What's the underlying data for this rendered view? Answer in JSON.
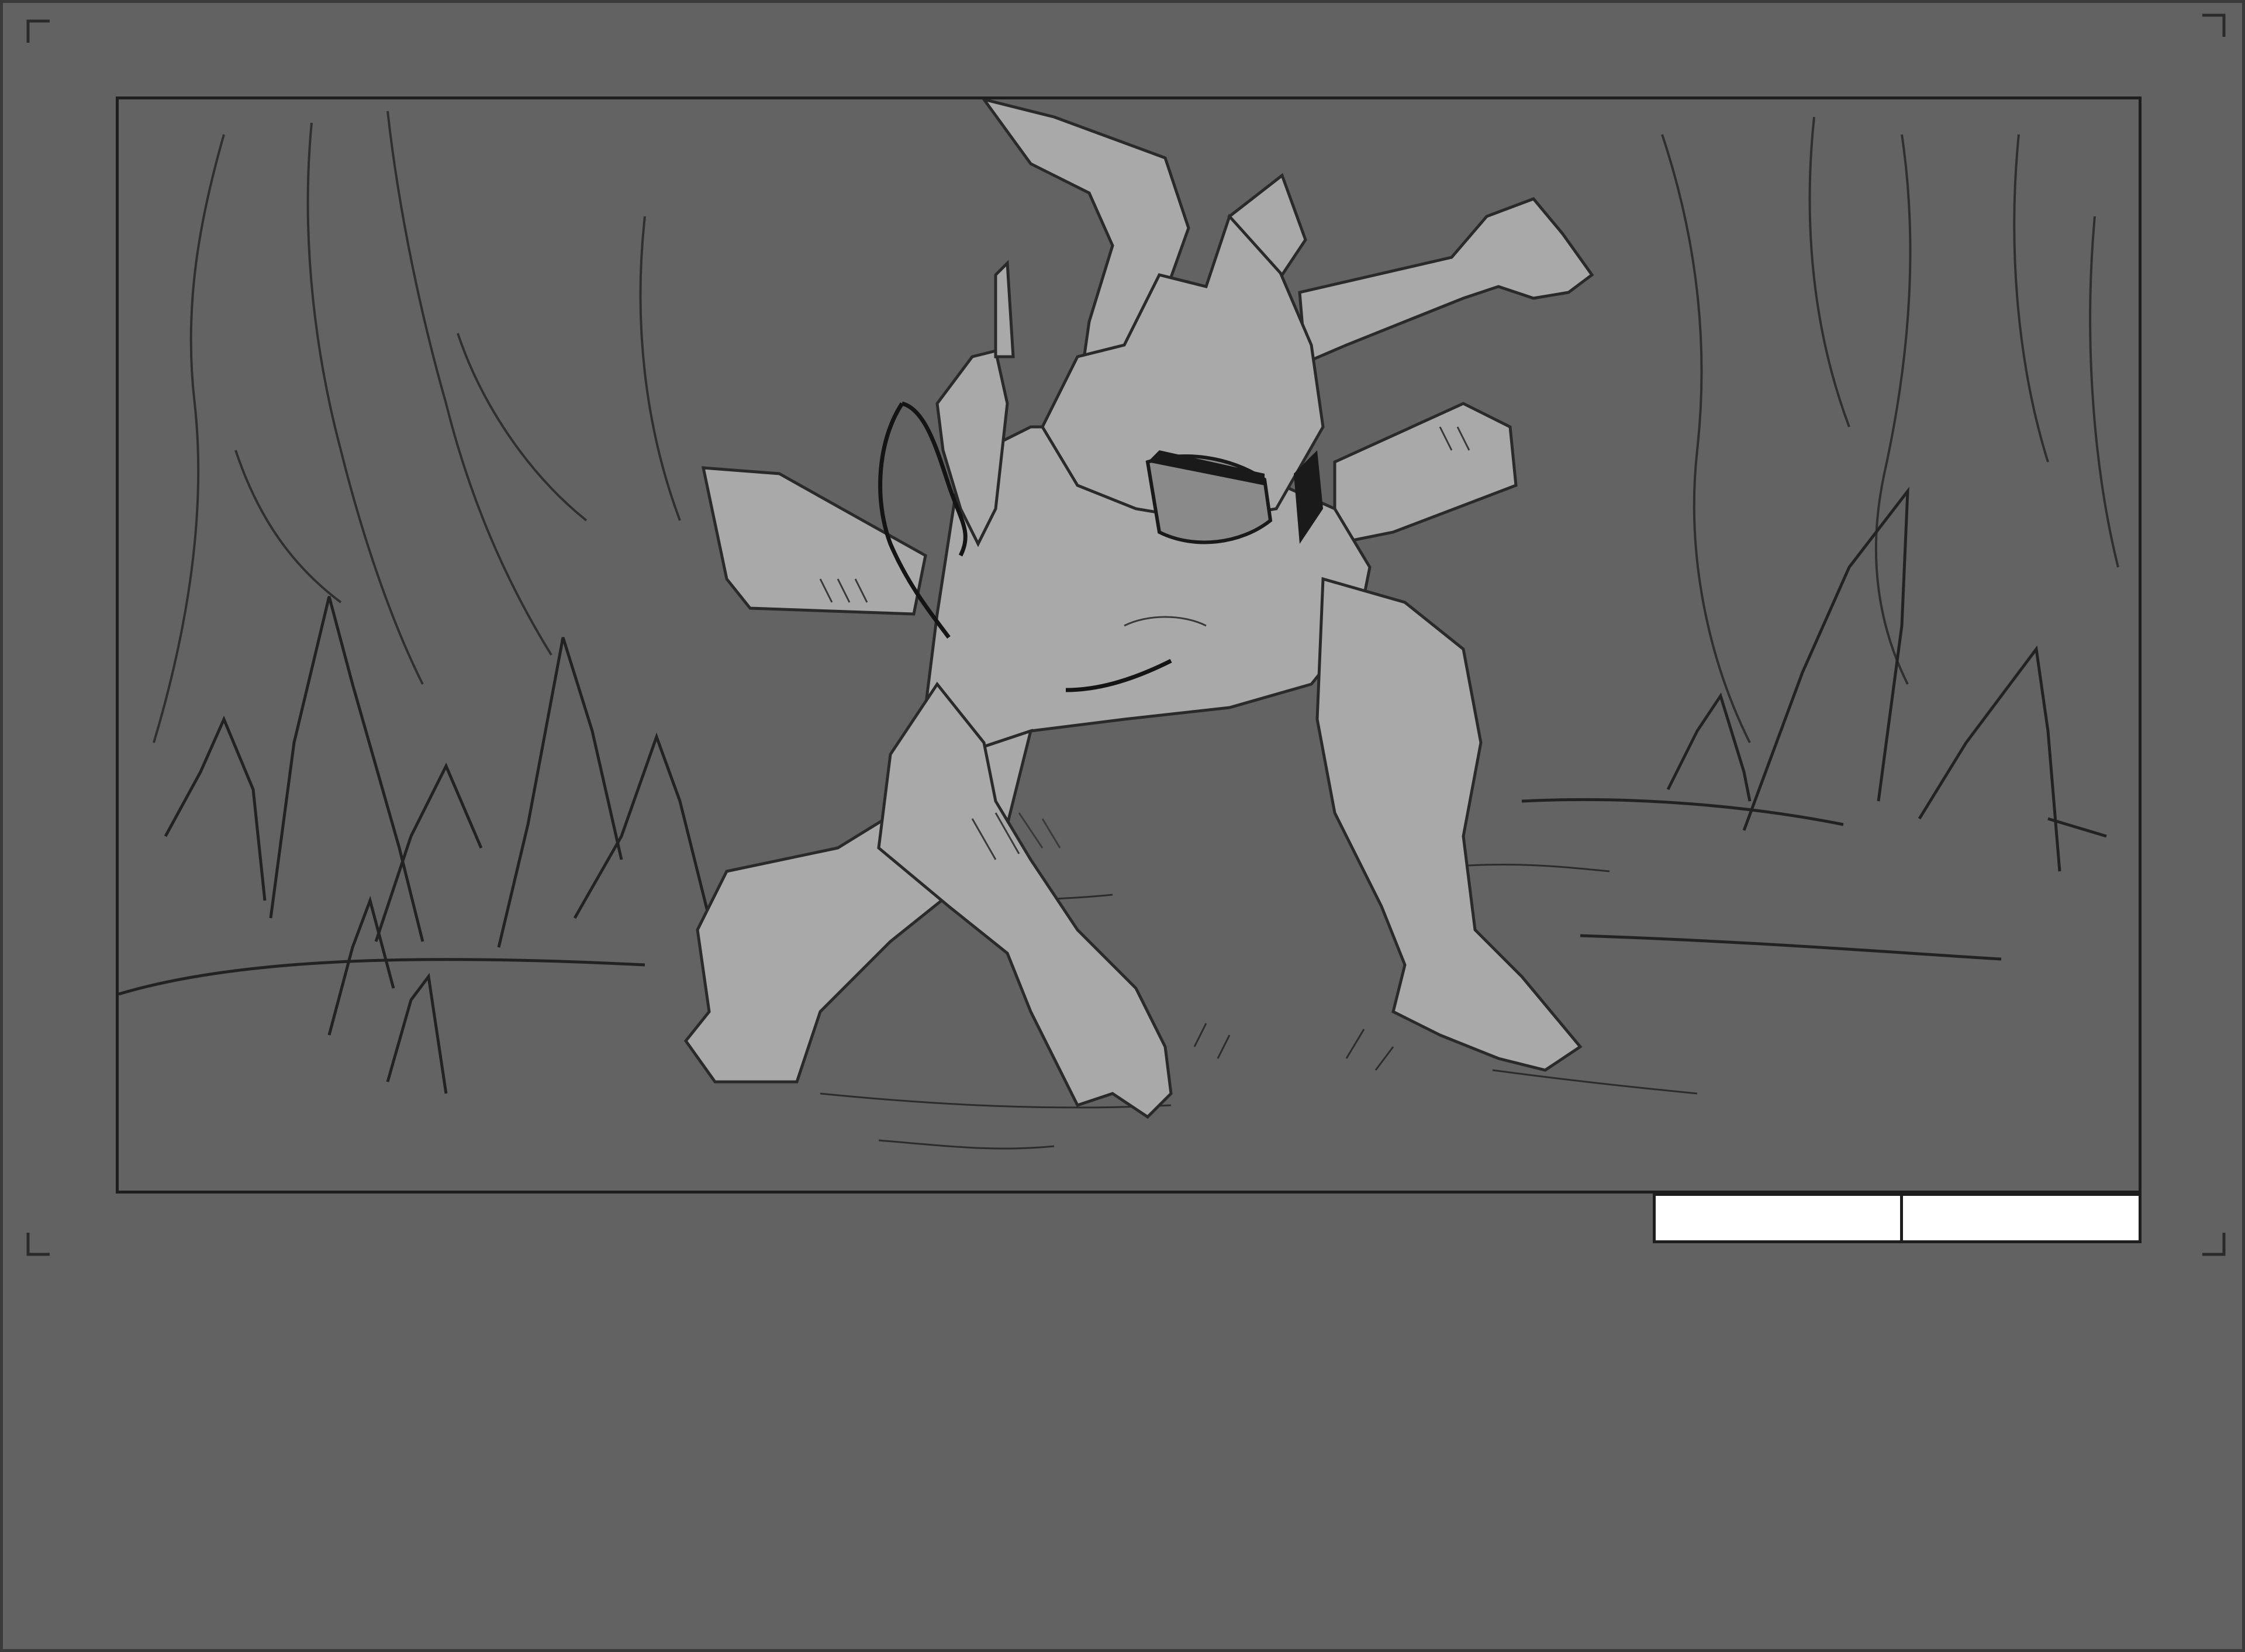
{
  "sheet": {
    "background_color": "#626262",
    "border_color": "#3a3a3a"
  },
  "panel": {
    "border_color": "#1e1e1e",
    "illustration": "crouching-masked-warrior-in-cave-sketch"
  },
  "caption_boxes": {
    "left_text": "",
    "right_text": "",
    "fill_color": "#ffffff"
  },
  "colors": {
    "figure_fill": "#a9a9a9",
    "line": "#2a2a2a",
    "chain": "#141414"
  }
}
